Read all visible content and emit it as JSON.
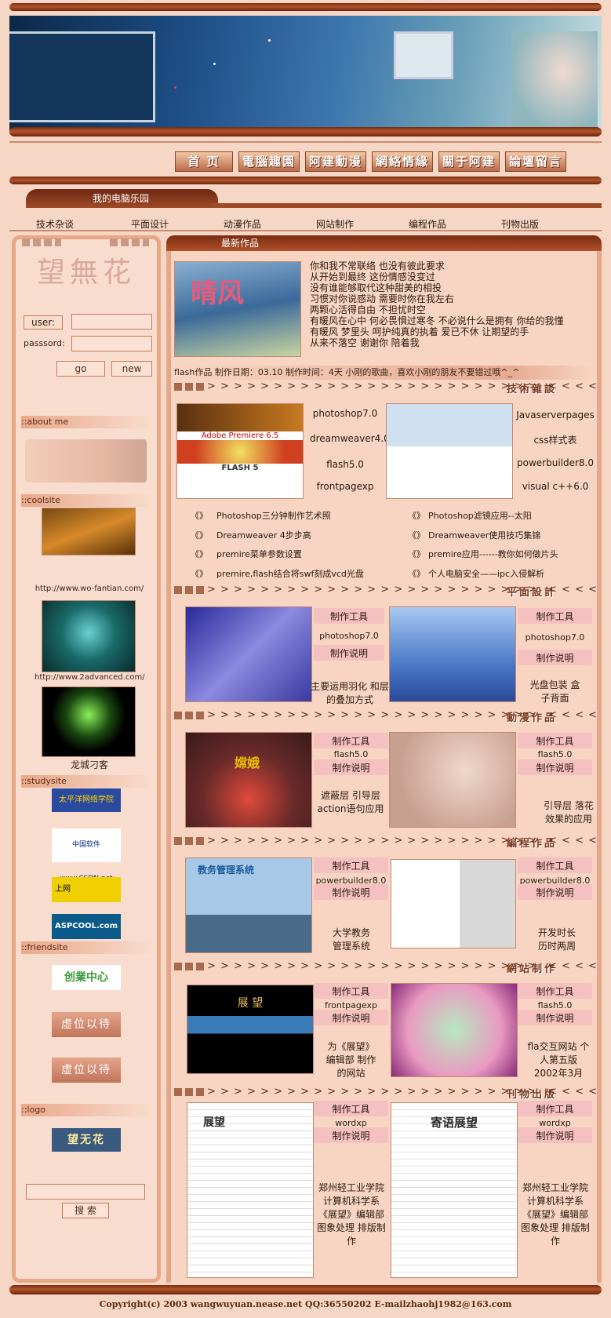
{
  "nav": [
    "首 页",
    "電腦趣園",
    "阿建動漫",
    "網絡情緣",
    "關于阿建",
    "論壇留言"
  ],
  "tab_label": "我的电脑乐园",
  "categories": [
    "技术杂谈",
    "平面设计",
    "动漫作品",
    "网站制作",
    "编程作品",
    "刊物出版"
  ],
  "sidebar": {
    "logo_text": "望無花",
    "user_label": "user:",
    "password_label": "passsord:",
    "go_label": "go",
    "new_label": "new",
    "about_header": "::about me",
    "coolsite_header": "::coolsite",
    "cool1_url": "http://www.wo-fantian.com/",
    "cool2_url": "http://www.2advanced.com/",
    "cool3_caption": "龙城刁客",
    "studysite_header": "::studysite",
    "study_logos": [
      "太平洋网络学院",
      "中国软件 www.CSDN.net",
      "上网",
      "ASPCOOL.com"
    ],
    "friendsite_header": "::friendsite",
    "friend_logo": "创業中心",
    "vacancy": [
      "虛位以待",
      "虛位以待"
    ],
    "logo_header": "::logo",
    "logo_badge": "望无花",
    "search_label": "搜 索"
  },
  "main": {
    "tab_label": "最新作品",
    "featured_title": "晴风",
    "lyrics": [
      "你和我不常联络 也没有彼此要求",
      "从开始到最终 这份情感没变过",
      "没有谁能够取代这种甜美的相投",
      "习惯对你说感动 需要时你在我左右",
      "两颗心活得自由 不担忧时空",
      "有暖风在心中 何必畏惧过寒冬 不必说什么是拥有 你给的我懂",
      "有暖风 梦里头 呵护纯真的执着 爱已不休 让期望的手",
      "从来不落空 谢谢你 陪着我"
    ],
    "flash_note": "flash作品 制作日期：03.10 制作时间：4天 小刚的歌曲，喜欢小刚的朋友不要错过哦^_^",
    "sections": [
      "技術雜談",
      "平面設計",
      "動漫作品",
      "編程作品",
      "網站制作",
      "刊物出版"
    ],
    "tech": {
      "tools_left": [
        "photoshop7.0",
        "dreamweaver4.0",
        "flash5.0",
        "frontpagexp"
      ],
      "tools_right": [
        "Javaserverpages",
        "css样式表",
        "powerbuilder8.0",
        "visual c++6.0"
      ],
      "premiere_label": "Adobe Premiere 6.5",
      "flash_label": "FLASH 5",
      "articles_left": [
        "Photoshop三分钟制作艺术照",
        "Dreamweaver 4步步高",
        "premire菜单参数设置",
        "premire,flash结合将swf刻成vcd光盘"
      ],
      "articles_right": [
        "Photoshop滤镜应用--太阳",
        "Dreamweaver使用技巧集锦",
        "premire应用------教你如何做片头",
        "个人电脑安全——ipc入侵解析"
      ],
      "bullet": "《》"
    },
    "labels": {
      "tool": "制作工具",
      "desc": "制作说明"
    },
    "graphic": [
      {
        "tool": "photoshop7.0",
        "desc": "主要运用羽化 和层的叠加方式"
      },
      {
        "tool": "photoshop7.0",
        "desc": "光盘包装 盒子背面"
      }
    ],
    "anime": [
      {
        "tool": "flash5.0",
        "desc": "遮蔽层 引导层 action语句应用",
        "title": "嫦娥"
      },
      {
        "tool": "flash5.0",
        "desc": "引导层 落花效果的应用"
      }
    ],
    "programming": [
      {
        "tool": "powerbuilder8.0",
        "desc": "大学教务 管理系统",
        "title": "教务管理系统"
      },
      {
        "tool": "powerbuilder8.0",
        "desc": "开发时长 历时两周"
      }
    ],
    "website": [
      {
        "tool": "frontpagexp",
        "desc": "为《展望》 编辑部 制作的网站",
        "title": "展 望"
      },
      {
        "tool": "flash5.0",
        "desc": "fla交互网站 个人第五版 2002年3月"
      }
    ],
    "publishing": [
      {
        "tool": "wordxp",
        "desc": "郑州轻工业学院 计算机科学系 《展望》编辑部 图象处理 排版制作",
        "title": "展望"
      },
      {
        "tool": "wordxp",
        "desc": "郑州轻工业学院 计算机科学系 《展望》编辑部 图象处理 排版制作",
        "title": "寄语展望"
      }
    ]
  },
  "footer": "Copyright(c) 2003 wangwuyuan.nease.net QQ:36550202 E-mailzhaohj1982@163.com"
}
